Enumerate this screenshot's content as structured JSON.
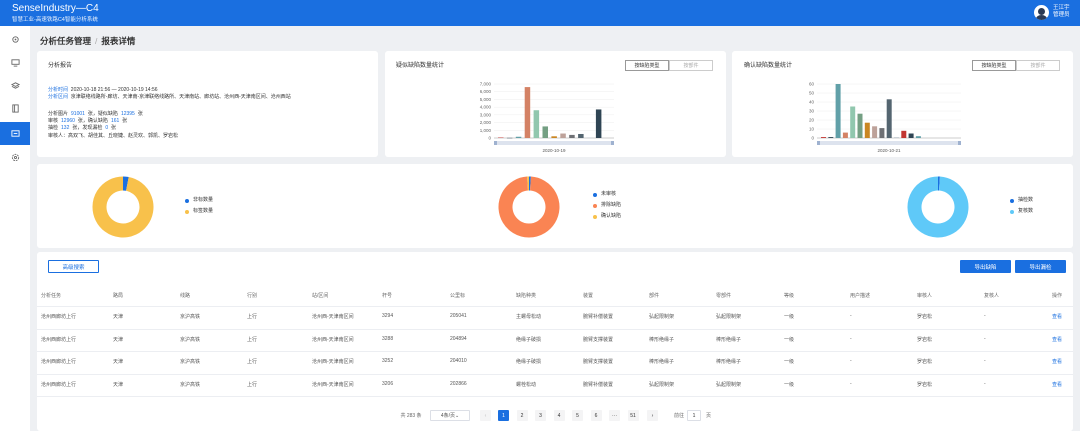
{
  "app": {
    "title": "SenseIndustry—C4",
    "subtitle": "智慧工业-高速铁路C4智能分析系统"
  },
  "user": {
    "name": "王江宇",
    "role": "管理员"
  },
  "sidebar": {
    "items": [
      {
        "icon": "settings-icon"
      },
      {
        "icon": "monitor-icon"
      },
      {
        "icon": "layers-icon"
      },
      {
        "icon": "book-icon"
      },
      {
        "icon": "report-icon",
        "active": true
      },
      {
        "icon": "gear-icon"
      }
    ]
  },
  "breadcrumb": {
    "parent": "分析任务管理",
    "current": "报表详情"
  },
  "report": {
    "title": "分析报告",
    "time_label": "分析时间",
    "time_value": "2020-10-18 21:56 — 2020-10-19 14:56",
    "area_label": "分析区间",
    "area_value": "京津联络线路所-廊坊、天津南-京津联络线路所、天津南站、廊坊站、沧州西-天津南区间、沧州西站",
    "l1": [
      {
        "t": "分析图片"
      },
      {
        "t": "91001",
        "n": 1
      },
      {
        "t": "张，疑似缺陷"
      },
      {
        "t": "12395",
        "n": 1
      },
      {
        "t": "张"
      }
    ],
    "l2": [
      {
        "t": "审核"
      },
      {
        "t": "12960",
        "n": 1
      },
      {
        "t": "张，确认缺陷"
      },
      {
        "t": "161",
        "n": 1
      },
      {
        "t": "张"
      }
    ],
    "l3": [
      {
        "t": "抽检"
      },
      {
        "t": "132",
        "n": 1
      },
      {
        "t": "张，发现漏检"
      },
      {
        "t": "0",
        "n": 1
      },
      {
        "t": "张"
      }
    ],
    "reviewers": "审核人：高双飞、胡佳其、丘晓婕、赵灵欢、郭凯、罗岩松"
  },
  "suspected": {
    "title": "疑似缺陷数量统计",
    "toggle": [
      "按缺陷类型",
      "按部件"
    ]
  },
  "confirmed": {
    "title": "确认缺陷数量统计",
    "toggle": [
      "按缺陷类型",
      "按部件"
    ]
  },
  "chart_data": [
    {
      "type": "bar",
      "title": "疑似缺陷数量统计",
      "ylim": [
        0,
        7000
      ],
      "yticks": [
        "7,000",
        "6,000",
        "5,000",
        "4,000",
        "3,000",
        "2,000",
        "1,000",
        "0"
      ],
      "xlabel_tick": "2020-10-19",
      "values": [
        60,
        20,
        160,
        6600,
        3600,
        1500,
        220,
        580,
        400,
        520,
        70,
        3700
      ],
      "colors": [
        "#c23531",
        "#2f4554",
        "#61a0a8",
        "#d48265",
        "#91c7ae",
        "#749f83",
        "#ca8622",
        "#bda29a",
        "#6e7074",
        "#546570",
        "#c4ccd3",
        "#2f4554"
      ]
    },
    {
      "type": "bar",
      "title": "确认缺陷数量统计",
      "ylim": [
        0,
        60
      ],
      "yticks": [
        "60",
        "50",
        "40",
        "30",
        "20",
        "10",
        "0"
      ],
      "xlabel_tick": "2020-10-21",
      "values": [
        1,
        1,
        60,
        6,
        35,
        27,
        17,
        13,
        11,
        43,
        1,
        8,
        5,
        2
      ],
      "colors": [
        "#c23531",
        "#2f4554",
        "#61a0a8",
        "#d48265",
        "#91c7ae",
        "#749f83",
        "#ca8622",
        "#bda29a",
        "#6e7074",
        "#546570",
        "#c4ccd3",
        "#c23531",
        "#2f4554",
        "#61a0a8"
      ]
    },
    {
      "type": "pie",
      "series": [
        {
          "name": "非标数量",
          "value": 3,
          "color": "#1a6fe0"
        },
        {
          "name": "标签数量",
          "value": 97,
          "color": "#f8c14b"
        }
      ]
    },
    {
      "type": "pie",
      "series": [
        {
          "name": "未审核",
          "value": 1,
          "color": "#1a6fe0"
        },
        {
          "name": "排除缺陷",
          "value": 98,
          "color": "#fa8453"
        },
        {
          "name": "确认缺陷",
          "value": 1,
          "color": "#f8c14b"
        }
      ]
    },
    {
      "type": "pie",
      "series": [
        {
          "name": "抽检数",
          "value": 1,
          "color": "#1a6fe0"
        },
        {
          "name": "复核数",
          "value": 99,
          "color": "#5fc9f8"
        }
      ]
    }
  ],
  "actions": {
    "search": "高级搜索",
    "export_defects": "导出缺陷",
    "export_misses": "导出漏检"
  },
  "table": {
    "headers": [
      "分析任务",
      "路局",
      "线路",
      "行别",
      "站/区间",
      "杆号",
      "公里标",
      "缺陷种类",
      "装置",
      "部件",
      "零部件",
      "等级",
      "用户描述",
      "审核人",
      "复核人",
      "操作"
    ],
    "rows": [
      [
        "沧州西廊坊上行",
        "天津",
        "京沪高铁",
        "上行",
        "沧州西-天津南区间",
        "3294",
        "205041",
        "主螺母松动",
        "腕臂补偿装置",
        "弘起限制架",
        "弘起限制架",
        "一级",
        "-",
        "罗岩松",
        "-",
        "查看"
      ],
      [
        "沧州西廊坊上行",
        "天津",
        "京沪高铁",
        "上行",
        "沧州西-天津南区间",
        "3288",
        "204894",
        "绝缘子破损",
        "腕臂支撑装置",
        "棒形绝缘子",
        "棒形绝缘子",
        "一级",
        "-",
        "罗岩松",
        "-",
        "查看"
      ],
      [
        "沧州西廊坊上行",
        "天津",
        "京沪高铁",
        "上行",
        "沧州西-天津南区间",
        "3252",
        "204010",
        "绝缘子破损",
        "腕臂支撑装置",
        "棒形绝缘子",
        "棒形绝缘子",
        "一级",
        "-",
        "罗岩松",
        "-",
        "查看"
      ],
      [
        "沧州西廊坊上行",
        "天津",
        "京沪高铁",
        "上行",
        "沧州西-天津南区间",
        "3206",
        "202866",
        "螺栓松动",
        "腕臂补偿装置",
        "弘起限制架",
        "弘起限制架",
        "一级",
        "-",
        "罗岩松",
        "-",
        "查看"
      ]
    ]
  },
  "pagination": {
    "total": "共 283 条",
    "per_page": "4条/页",
    "prev": "‹",
    "next": "›",
    "pages": [
      "1",
      "2",
      "3",
      "4",
      "5",
      "6",
      "···",
      "51"
    ],
    "goto_label": "前往",
    "goto_value": "1",
    "goto_suffix": "页"
  }
}
